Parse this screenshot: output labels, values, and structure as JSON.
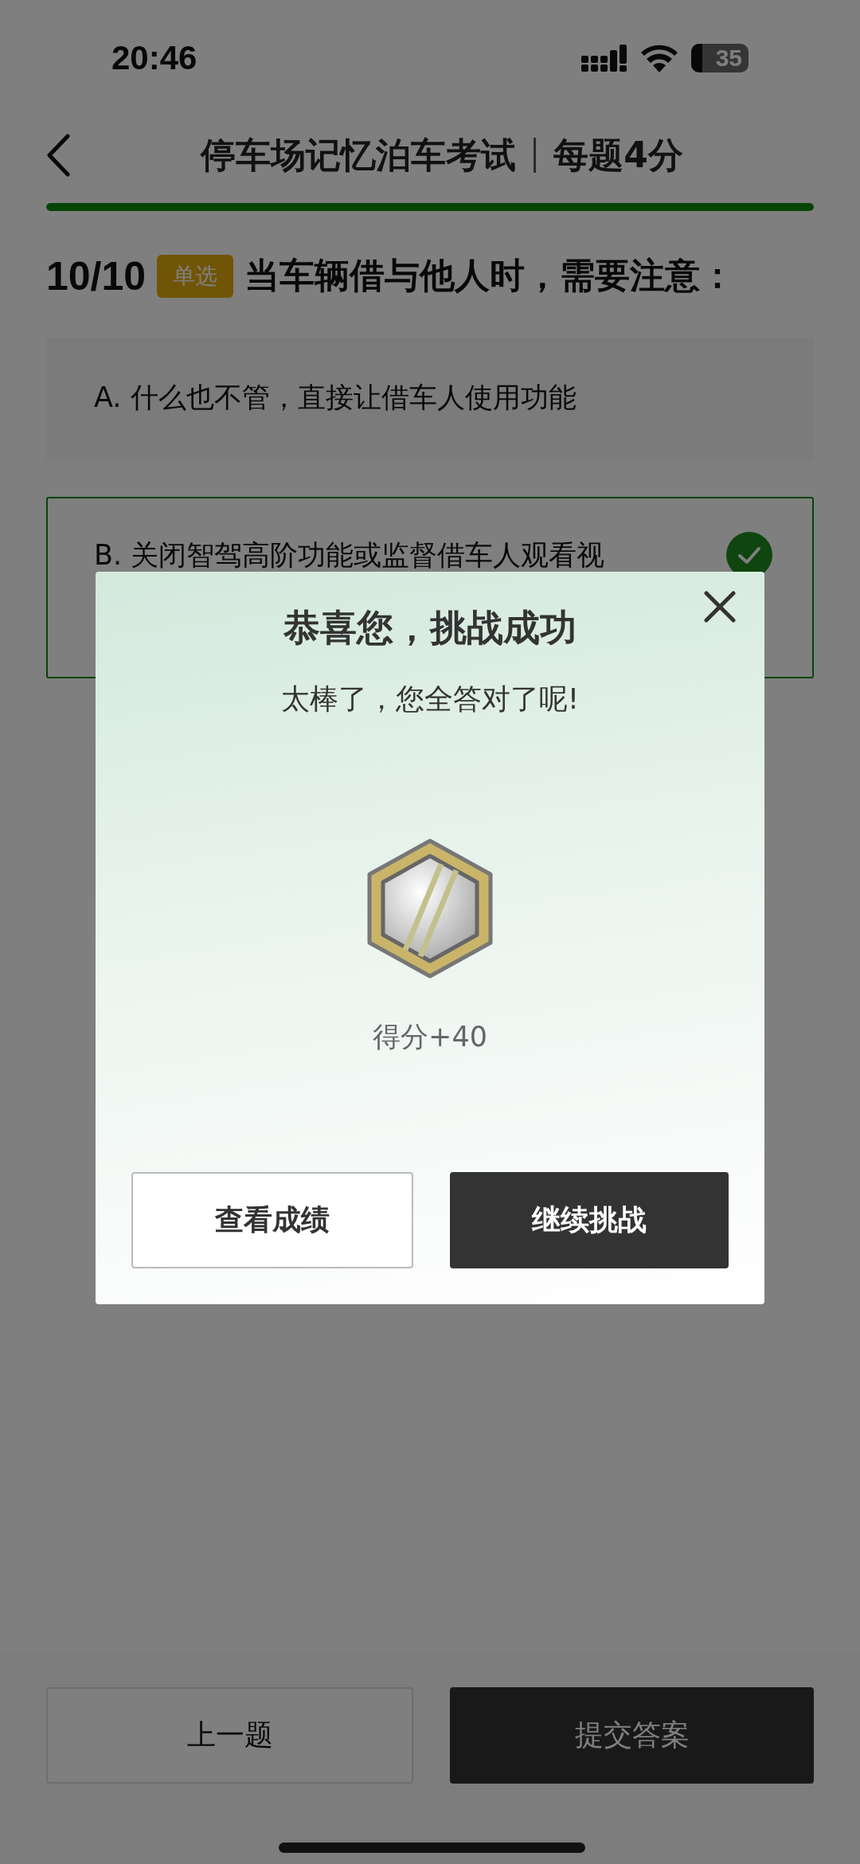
{
  "status_bar": {
    "time": "20:46",
    "battery": "35"
  },
  "header": {
    "title": "停车场记忆泊车考试",
    "subtitle": "每题4分"
  },
  "progress": {
    "level": 1
  },
  "question": {
    "number": "10/10",
    "tag": "单选",
    "text": "当车辆借与他人时，需要注意："
  },
  "options": [
    {
      "text": "A. 什么也不管，直接让借车人使用功能",
      "selected": false
    },
    {
      "text": "B. 关闭智驾高阶功能或监督借车人观看视",
      "selected": true
    }
  ],
  "dialog": {
    "title": "恭喜您，挑战成功",
    "message": "太棒了，您全答对了呢!",
    "score": "得分+40",
    "buttons": [
      {
        "label": "查看成绩",
        "kind": "secondary"
      },
      {
        "label": "继续挑战",
        "kind": "primary"
      }
    ]
  },
  "footer": {
    "buttons": [
      {
        "label": "上一题",
        "kind": "secondary"
      },
      {
        "label": "提交答案",
        "kind": "primary"
      }
    ]
  }
}
